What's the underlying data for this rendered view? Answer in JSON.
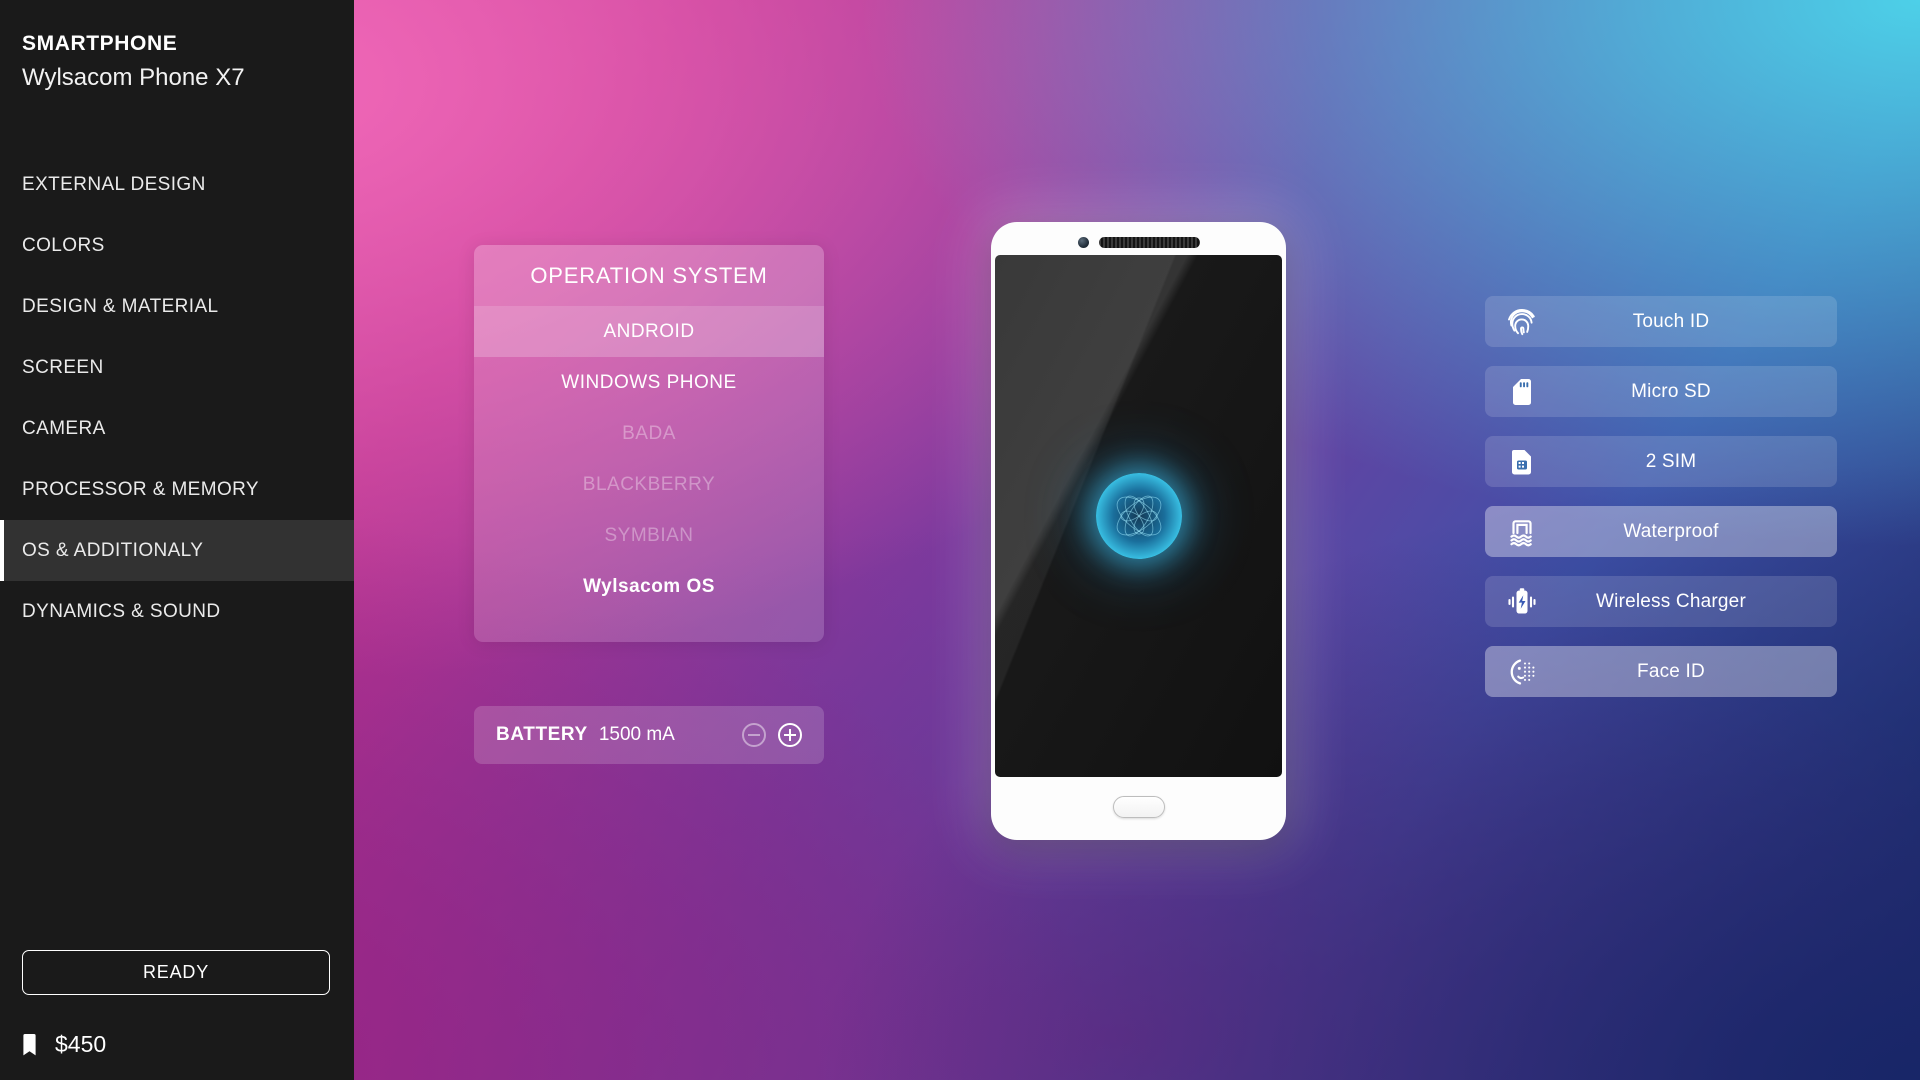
{
  "sidebar": {
    "brand_title": "SMARTPHONE",
    "brand_model": "Wylsacom Phone X7",
    "nav_items": [
      {
        "label": "EXTERNAL DESIGN",
        "active": false
      },
      {
        "label": "COLORS",
        "active": false
      },
      {
        "label": "DESIGN & MATERIAL",
        "active": false
      },
      {
        "label": "SCREEN",
        "active": false
      },
      {
        "label": "CAMERA",
        "active": false
      },
      {
        "label": "PROCESSOR & MEMORY",
        "active": false
      },
      {
        "label": "OS & ADDITIONALY",
        "active": true
      },
      {
        "label": "DYNAMICS & SOUND",
        "active": false
      }
    ],
    "ready_button": "READY",
    "price": "$450",
    "price_icon": "price-tag-icon"
  },
  "os_panel": {
    "title": "OPERATION SYSTEM",
    "options": [
      {
        "label": "ANDROID",
        "state": "selected"
      },
      {
        "label": "WINDOWS PHONE",
        "state": "available"
      },
      {
        "label": "BADA",
        "state": "disabled"
      },
      {
        "label": "BLACKBERRY",
        "state": "disabled"
      },
      {
        "label": "SYMBIAN",
        "state": "disabled"
      },
      {
        "label": "Wylsacom OS",
        "state": "brand"
      }
    ]
  },
  "battery_panel": {
    "label": "BATTERY",
    "value": "1500 mA",
    "decrease_icon": "minus-circle-icon",
    "increase_icon": "plus-circle-icon",
    "decrease_enabled": false,
    "increase_enabled": true
  },
  "features": [
    {
      "label": "Touch ID",
      "icon": "fingerprint-icon",
      "selected": false
    },
    {
      "label": "Micro SD",
      "icon": "sd-card-icon",
      "selected": false
    },
    {
      "label": "2 SIM",
      "icon": "sim-card-icon",
      "selected": false
    },
    {
      "label": "Waterproof",
      "icon": "waterproof-icon",
      "selected": true
    },
    {
      "label": "Wireless Charger",
      "icon": "wireless-charger-icon",
      "selected": false
    },
    {
      "label": "Face ID",
      "icon": "face-id-icon",
      "selected": true
    }
  ],
  "phone_preview": {
    "camera_icon": "front-camera-icon",
    "speaker_icon": "earpiece-speaker-icon",
    "logo_icon": "wylsacom-logo-icon",
    "home_button_icon": "home-button-icon"
  },
  "colors": {
    "sidebar_bg": "#1a1a1a",
    "sidebar_active_bg": "#323232",
    "accent_white": "#ffffff",
    "bg_top_left": "#f068b8",
    "bg_top_right": "#4dd0e8",
    "bg_bottom_left": "#9d2080",
    "bg_bottom_center": "#70318f",
    "bg_bottom_right": "#1d2a68",
    "phone_body": "#fdfdfd",
    "logo_glow": "#3cc8eb"
  }
}
